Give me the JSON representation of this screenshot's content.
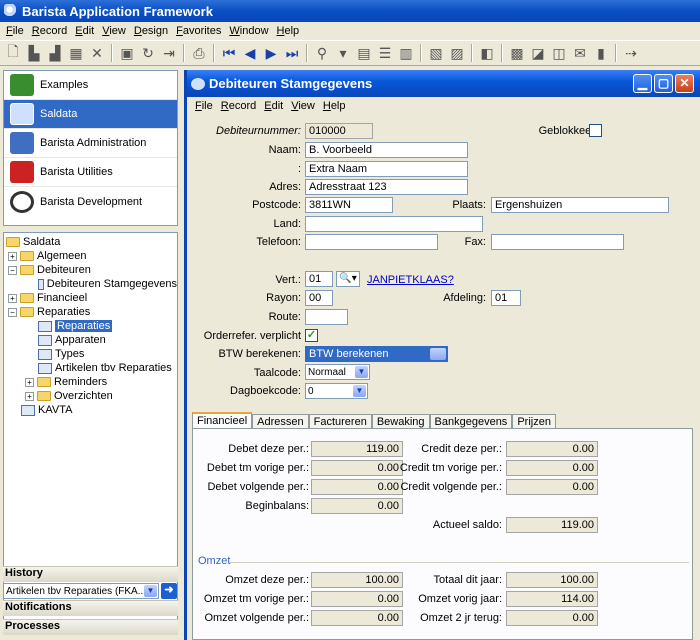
{
  "app": {
    "title": "Barista Application Framework"
  },
  "menubar": [
    "File",
    "Record",
    "Edit",
    "View",
    "Design",
    "Favorites",
    "Window",
    "Help"
  ],
  "sidebar": {
    "nav": [
      {
        "label": "Examples",
        "color": "#3a8d2e"
      },
      {
        "label": "Saldata",
        "color": "#4d7fc9"
      },
      {
        "label": "Barista Administration",
        "color": "#3e6fc0"
      },
      {
        "label": "Barista Utilities",
        "color": "#cc2222"
      },
      {
        "label": "Barista Development",
        "color": "#333333"
      }
    ],
    "tree": [
      {
        "label": "Saldata",
        "level": 0,
        "exp": "",
        "icon": "folder"
      },
      {
        "label": "Algemeen",
        "level": 1,
        "exp": "+",
        "icon": "folder"
      },
      {
        "label": "Debiteuren",
        "level": 1,
        "exp": "-",
        "icon": "folder"
      },
      {
        "label": "Debiteuren Stamgegevens",
        "level": 2,
        "exp": "",
        "icon": "doc"
      },
      {
        "label": "Financieel",
        "level": 1,
        "exp": "+",
        "icon": "folder"
      },
      {
        "label": "Reparaties",
        "level": 1,
        "exp": "-",
        "icon": "folder"
      },
      {
        "label": "Reparaties",
        "level": 2,
        "exp": "",
        "icon": "doc",
        "selected": true
      },
      {
        "label": "Apparaten",
        "level": 2,
        "exp": "",
        "icon": "doc"
      },
      {
        "label": "Types",
        "level": 2,
        "exp": "",
        "icon": "doc"
      },
      {
        "label": "Artikelen tbv Reparaties",
        "level": 2,
        "exp": "",
        "icon": "doc"
      },
      {
        "label": "Reminders",
        "level": 2,
        "exp": "+",
        "icon": "folder"
      },
      {
        "label": "Overzichten",
        "level": 2,
        "exp": "+",
        "icon": "folder"
      },
      {
        "label": "KAVTA",
        "level": 1,
        "exp": "",
        "icon": "doc"
      }
    ],
    "history_label": "History",
    "history_value": "Artikelen tbv Reparaties (FKA...",
    "notifications_label": "Notifications",
    "processes_label": "Processes"
  },
  "window": {
    "title": "Debiteuren Stamgegevens",
    "menu": [
      "File",
      "Record",
      "Edit",
      "View",
      "Help"
    ]
  },
  "form": {
    "debiteurnummer_label": "Debiteurnummer:",
    "debiteurnummer": "010000",
    "geblokkeerd_label": "Geblokkeerd",
    "naam_label": "Naam:",
    "naam": "B. Voorbeeld",
    "naam2_label": ":",
    "naam2": "Extra Naam",
    "adres_label": "Adres:",
    "adres": "Adresstraat 123",
    "postcode_label": "Postcode:",
    "postcode": "3811WN",
    "plaats_label": "Plaats:",
    "plaats": "Ergenshuizen",
    "land_label": "Land:",
    "land": "",
    "telefoon_label": "Telefoon:",
    "telefoon": "",
    "fax_label": "Fax:",
    "fax": "",
    "vert_label": "Vert.:",
    "vert": "01",
    "vert_link": "JANPIETKLAAS?",
    "rayon_label": "Rayon:",
    "rayon": "00",
    "afdeling_label": "Afdeling:",
    "afdeling": "01",
    "route_label": "Route:",
    "route": "",
    "orderref_label": "Orderrefer. verplicht",
    "btw_label": "BTW berekenen:",
    "btw": "BTW berekenen",
    "taalcode_label": "Taalcode:",
    "taalcode": "Normaal",
    "dagboek_label": "Dagboekcode:",
    "dagboek": "0"
  },
  "tabs": [
    "Financieel",
    "Adressen",
    "Factureren",
    "Bewaking",
    "Bankgegevens",
    "Prijzen"
  ],
  "financieel": {
    "left": [
      {
        "label": "Debet deze per.:",
        "value": "119.00"
      },
      {
        "label": "Debet tm vorige per.:",
        "value": "0.00"
      },
      {
        "label": "Debet volgende per.:",
        "value": "0.00"
      },
      {
        "label": "Beginbalans:",
        "value": "0.00"
      }
    ],
    "right": [
      {
        "label": "Credit deze per.:",
        "value": "0.00"
      },
      {
        "label": "Credit tm vorige per.:",
        "value": "0.00"
      },
      {
        "label": "Credit volgende per.:",
        "value": "0.00"
      }
    ],
    "saldo_label": "Actueel saldo:",
    "saldo": "119.00",
    "omzet_title": "Omzet",
    "omzet_left": [
      {
        "label": "Omzet deze per.:",
        "value": "100.00"
      },
      {
        "label": "Omzet tm vorige per.:",
        "value": "0.00"
      },
      {
        "label": "Omzet volgende per.:",
        "value": "0.00"
      }
    ],
    "omzet_right": [
      {
        "label": "Totaal dit jaar:",
        "value": "100.00"
      },
      {
        "label": "Omzet vorig jaar:",
        "value": "114.00"
      },
      {
        "label": "Omzet 2 jr terug:",
        "value": "0.00"
      }
    ]
  }
}
